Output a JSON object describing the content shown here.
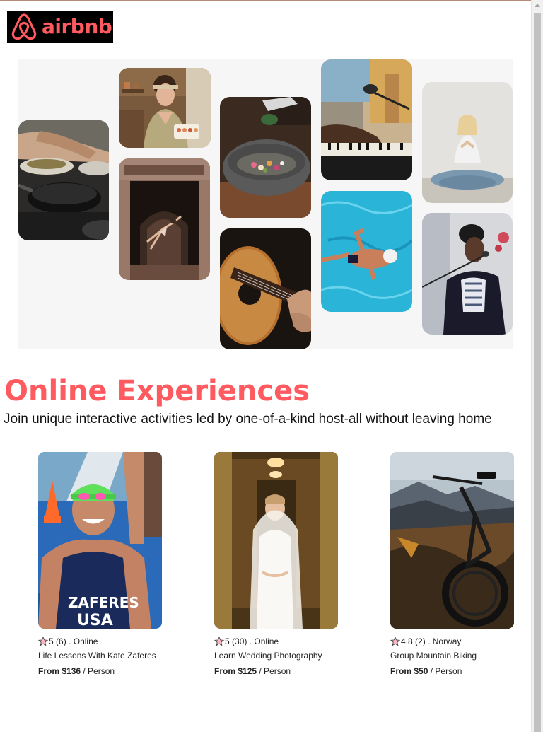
{
  "brand": {
    "name": "airbnb",
    "color": "#ff5a5f"
  },
  "hero": {
    "photos": [
      {
        "icon": "cooking-photo"
      },
      {
        "icon": "baking-host-photo"
      },
      {
        "icon": "dancer-doorway-photo"
      },
      {
        "icon": "food-bowl-photo"
      },
      {
        "icon": "guitar-photo"
      },
      {
        "icon": "piano-microphone-photo"
      },
      {
        "icon": "swimmer-pool-photo"
      },
      {
        "icon": "yoga-photo"
      },
      {
        "icon": "singer-photo"
      }
    ]
  },
  "section": {
    "title": "Online Experiences",
    "subtitle": "Join unique interactive activities led by one-of-a-kind host-all without leaving home"
  },
  "cards": [
    {
      "rating": "5",
      "reviews": "(6)",
      "separator": ".",
      "location": "Online",
      "title": "Life Lessons With Kate Zaferes",
      "price_prefix": "From",
      "price": "$136",
      "price_suffix": "/ Person",
      "photo": "swimmer-zaferes-photo"
    },
    {
      "rating": "5",
      "reviews": "(30)",
      "separator": ".",
      "location": "Online",
      "title": "Learn Wedding Photography",
      "price_prefix": "From",
      "price": "$125",
      "price_suffix": "/ Person",
      "photo": "bride-photo"
    },
    {
      "rating": "4.8",
      "reviews": "(2)",
      "separator": ".",
      "location": "Norway",
      "title": "Group Mountain Biking",
      "price_prefix": "From",
      "price": "$50",
      "price_suffix": "/ Person",
      "photo": "mountain-bike-photo"
    }
  ],
  "colors": {
    "accent": "#ff5a5f",
    "hero_bg": "#f6f6f6",
    "star": "#ff5a5f"
  }
}
